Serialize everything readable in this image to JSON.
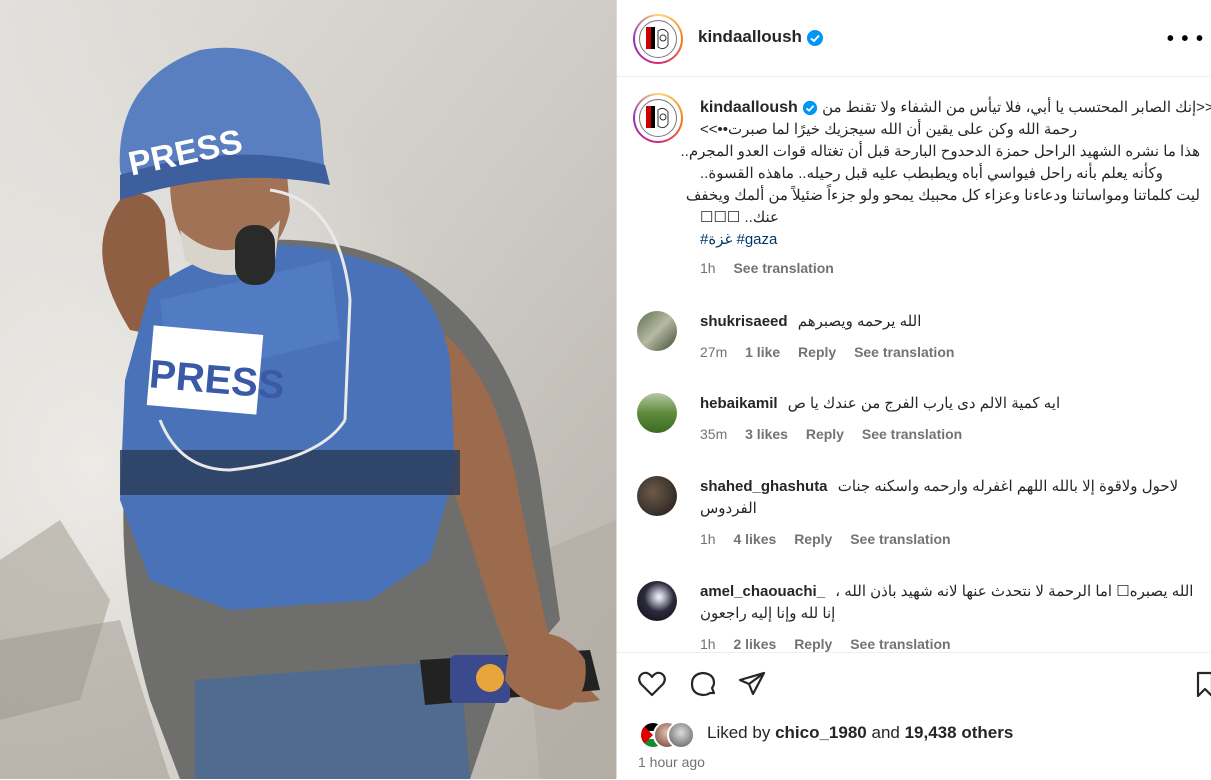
{
  "post": {
    "username": "kindaalloush",
    "caption_lines": [
      "<<إنك الصابر المحتسب يا أبي، فلا تيأس من الشفاء ولا تقنط من",
      "رحمة الله وكن على يقين أن الله سيجزيك خيرًا لما صبرت••>>",
      "هذا ما نشره الشهيد الراحل حمزة الدحدوح البارحة قبل أن تغتاله قوات العدو المجرم..",
      "وكأنه يعلم بأنه راحل فيواسي أباه ويطبطب عليه قبل رحيله.. ماهذه القسوة..",
      "ليت كلماتنا ومواساتنا ودعاءنا وعزاء كل محبيك يمحو ولو جزءاً ضئيلاً من ألمك ويخفف",
      "عنك.. ☐☐☐"
    ],
    "hashtags": "#غزة #gaza",
    "time": "1h",
    "see_translation": "See translation"
  },
  "photo": {
    "vest_text_helmet": "PRESS",
    "vest_text_chest": "PRESS"
  },
  "comments": [
    {
      "user": "shukrisaeed",
      "text": "الله يرحمه ويصبرهم",
      "time": "27m",
      "likes": "1 like",
      "reply": "Reply",
      "translation": "See translation"
    },
    {
      "user": "hebaikamil",
      "text": "ايه كمية الالم دى يارب الفرج من عندك يا ص",
      "time": "35m",
      "likes": "3 likes",
      "reply": "Reply",
      "translation": "See translation"
    },
    {
      "user": "shahed_ghashuta",
      "text_line1": "لاحول ولاقوة إلا بالله اللهم اغفرله وارحمه واسكنه جنات",
      "text_line2": "الفردوس",
      "time": "1h",
      "likes": "4 likes",
      "reply": "Reply",
      "translation": "See translation"
    },
    {
      "user": "amel_chaouachi_",
      "text_line1": "الله يصبره☐ اما الرحمة لا نتحدث عنها لانه شهيد باذن الله ،",
      "text_line2": "إنا لله وإنا إليه راجعون",
      "time": "1h",
      "likes": "2 likes",
      "reply": "Reply",
      "translation": "See translation"
    }
  ],
  "footer": {
    "liked_prefix": "Liked by",
    "liked_user": "chico_1980",
    "liked_and": "and",
    "liked_others": "19,438 others",
    "time_ago": "1 hour ago"
  },
  "colors": {
    "link": "#00376b",
    "verified": "#0095f6",
    "muted": "#737373"
  },
  "icons": [
    "heart-icon",
    "comment-icon",
    "share-icon",
    "bookmark-icon",
    "verified-icon",
    "more-options-icon"
  ]
}
